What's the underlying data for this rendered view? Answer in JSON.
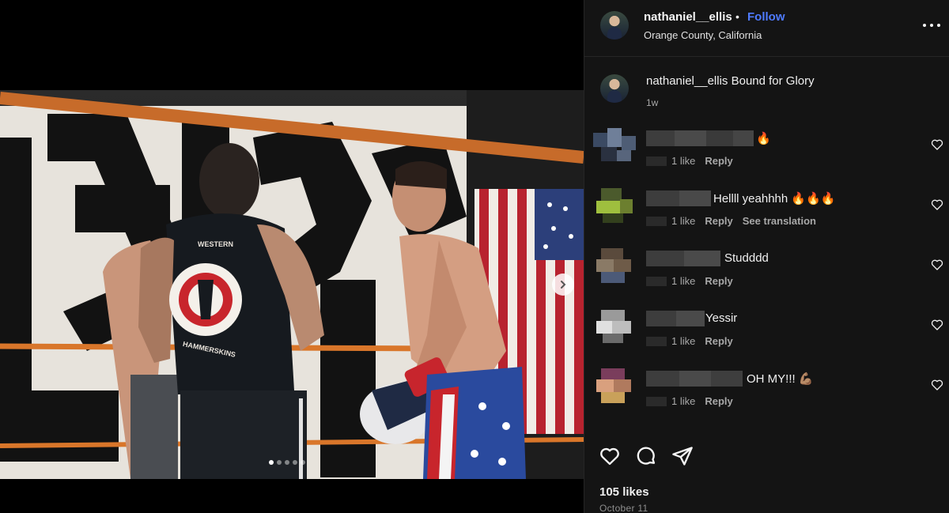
{
  "post": {
    "username": "nathaniel__ellis",
    "separator": "•",
    "follow_label": "Follow",
    "location": "Orange County, California",
    "caption_user": "nathaniel__ellis",
    "caption_text": "Bound for Glory",
    "caption_time": "1w",
    "likes": "105 likes",
    "date": "October 11"
  },
  "media": {
    "slide_count": 5,
    "active_slide": 1,
    "shirt_text_top": "WESTERN",
    "shirt_text_bottom": "HAMMERSKINS"
  },
  "comments": [
    {
      "text": "🔥",
      "likes": "1 like",
      "reply": "Reply",
      "translation": ""
    },
    {
      "text": "Hellll yeahhhh 🔥🔥🔥",
      "likes": "1 like",
      "reply": "Reply",
      "translation": "See translation"
    },
    {
      "text": "Studddd",
      "likes": "1 like",
      "reply": "Reply",
      "translation": ""
    },
    {
      "text": "Yessir",
      "likes": "1 like",
      "reply": "Reply",
      "translation": ""
    },
    {
      "text": "OH MY!!! 💪🏽",
      "likes": "1 like",
      "reply": "Reply",
      "translation": ""
    }
  ],
  "colors": {
    "accent_follow": "#4f7bff",
    "panel_bg": "#141414",
    "ring_rope": "#d9762a"
  },
  "icons": [
    "more-options-icon",
    "next-slide-icon",
    "heart-icon",
    "comment-icon",
    "share-icon"
  ]
}
